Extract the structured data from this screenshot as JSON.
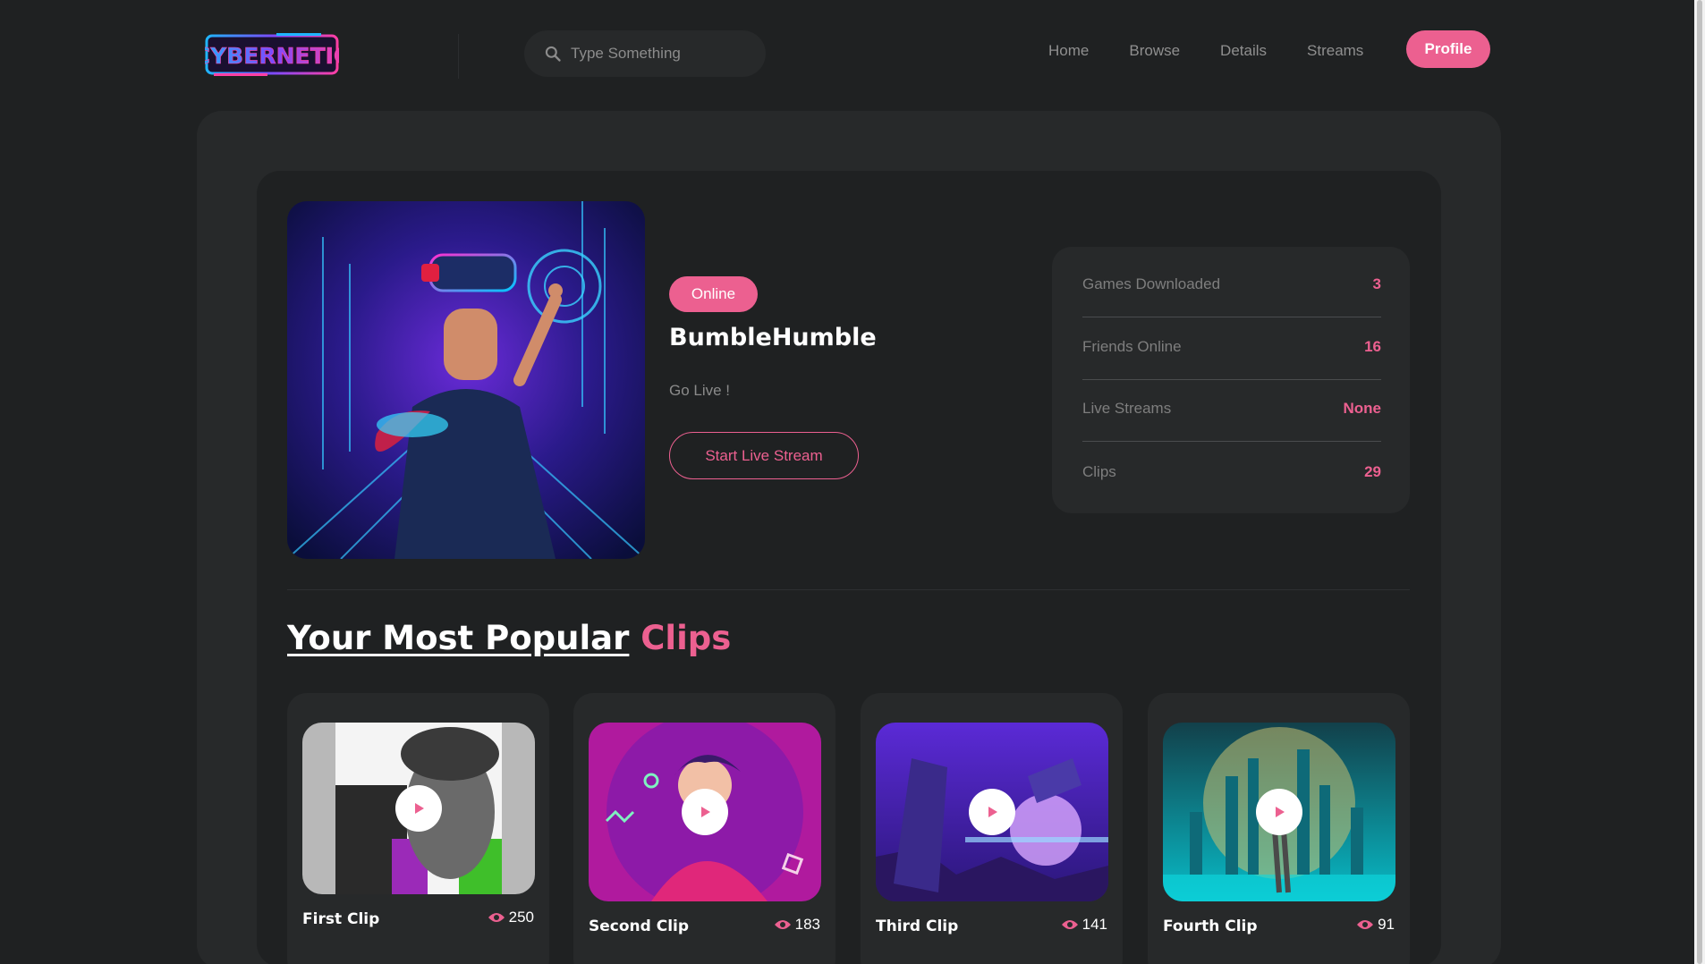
{
  "header": {
    "logo_text": "CYBERNETIC",
    "search_placeholder": "Type Something",
    "nav": [
      "Home",
      "Browse",
      "Details",
      "Streams"
    ],
    "profile_label": "Profile"
  },
  "profile": {
    "status": "Online",
    "username": "BumbleHumble",
    "tagline": "Go Live !",
    "live_button": "Start Live Stream"
  },
  "stats": [
    {
      "label": "Games Downloaded",
      "value": "3"
    },
    {
      "label": "Friends Online",
      "value": "16"
    },
    {
      "label": "Live Streams",
      "value": "None"
    },
    {
      "label": "Clips",
      "value": "29"
    }
  ],
  "clips_section": {
    "title_part1": "Your Most Popular",
    "title_part2": "Clips"
  },
  "clips": [
    {
      "name": "First Clip",
      "views": "250"
    },
    {
      "name": "Second Clip",
      "views": "183"
    },
    {
      "name": "Third Clip",
      "views": "141"
    },
    {
      "name": "Fourth Clip",
      "views": "91"
    }
  ],
  "colors": {
    "accent": "#ec6090",
    "background": "#1f2122",
    "surface": "#27292a"
  },
  "icons": {
    "search": "search-icon",
    "views": "eye-icon",
    "play": "play-icon"
  }
}
